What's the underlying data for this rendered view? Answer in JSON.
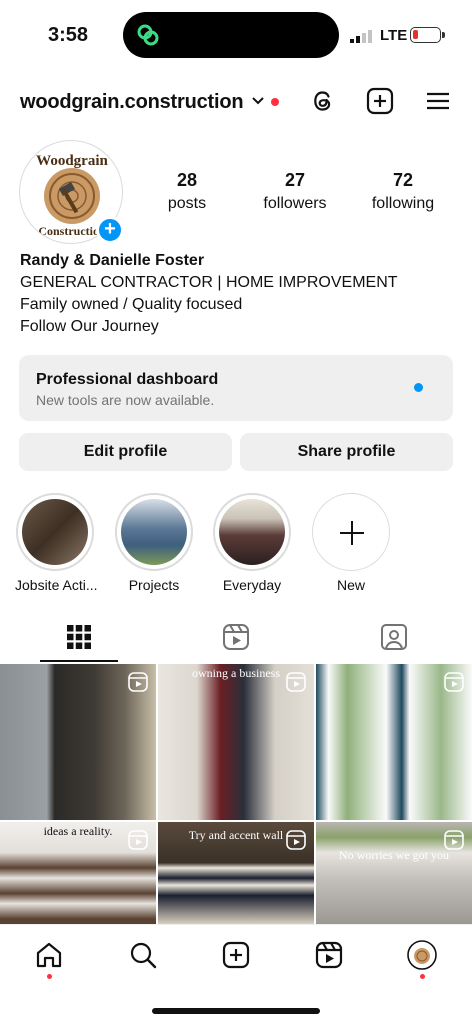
{
  "status_bar": {
    "time": "3:58",
    "network": "LTE"
  },
  "header": {
    "username": "woodgrain.construction"
  },
  "profile": {
    "logo_text_top": "Woodgrain",
    "logo_text_bottom": "Construction",
    "stats": [
      {
        "value": "28",
        "label": "posts"
      },
      {
        "value": "27",
        "label": "followers"
      },
      {
        "value": "72",
        "label": "following"
      }
    ],
    "name": "Randy & Danielle Foster",
    "bio_lines": [
      "GENERAL CONTRACTOR | HOME IMPROVEMENT",
      "Family owned / Quality focused",
      "Follow Our Journey"
    ]
  },
  "dashboard": {
    "title": "Professional dashboard",
    "subtitle": "New tools are now available."
  },
  "buttons": {
    "edit": "Edit profile",
    "share": "Share profile"
  },
  "highlights": [
    {
      "label": "Jobsite Acti..."
    },
    {
      "label": "Projects"
    },
    {
      "label": "Everyday"
    },
    {
      "label": "New"
    }
  ],
  "grid": {
    "captions": {
      "p2": "owning a business",
      "p4": "ideas a reality.",
      "p5": "Try and accent wall",
      "p6": "No worries we got you"
    }
  },
  "colors": {
    "accent": "#0095f6",
    "notification": "#ff3040",
    "button_bg": "#efefef",
    "muted": "#737373"
  },
  "icons": {
    "header": [
      "threads-icon",
      "create-plus-icon",
      "menu-icon"
    ],
    "tabs": [
      "grid-icon",
      "reels-icon",
      "tagged-icon"
    ],
    "nav": [
      "home-icon",
      "search-icon",
      "create-icon",
      "reels-icon",
      "profile-avatar"
    ]
  }
}
